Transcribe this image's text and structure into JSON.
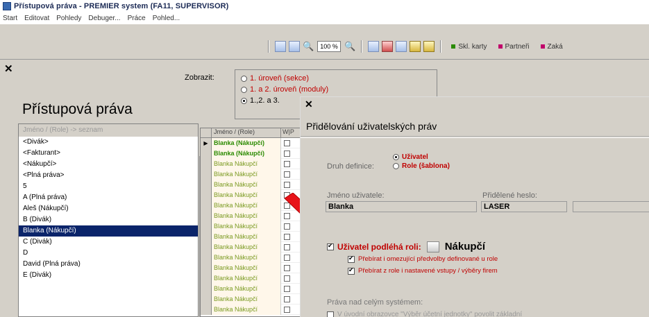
{
  "window": {
    "title": "Přístupová práva - PREMIER system (FA11, SUPERVISOR)"
  },
  "menu": [
    "Start",
    "Editovat",
    "Pohledy",
    "Debuger...",
    "Práce",
    "Pohled..."
  ],
  "toolbar": {
    "zoom": "100 %",
    "links": [
      {
        "label": "Skl. karty",
        "color": "#2a8a00"
      },
      {
        "label": "Partneři",
        "color": "#c0006a"
      },
      {
        "label": "Zaká",
        "color": "#c0006a"
      }
    ]
  },
  "main": {
    "display_label": "Zobrazit:",
    "levels": [
      {
        "label": "1. úroveň (sekce)",
        "selected": false,
        "highlight": true
      },
      {
        "label": "1. a 2. úroveň (moduly)",
        "selected": false,
        "highlight": true
      },
      {
        "label": "1.,2. a 3.",
        "selected": true,
        "highlight": false
      }
    ],
    "page_title": "Přístupová práva",
    "list_header": "Jméno / (Role) -> seznam",
    "list_items": [
      "<Divák>",
      "<Fakturant>",
      "<Nákupčí>",
      "<Plná práva>",
      "5",
      "A (Plná práva)",
      "Aleš (Nákupčí)",
      "B (Divák)",
      "Blanka (Nákupčí)",
      "C (Divák)",
      "D",
      "David (Plná práva)",
      "E (Divák)"
    ],
    "selected_index": 8,
    "grid_headers": {
      "name": "Jméno / (Role)",
      "col": "W|P"
    },
    "grid_rows": [
      "Blanka (Nákupčí)",
      "Blanka (Nákupčí)",
      "Blanka Nákupčí",
      "Blanka Nákupčí",
      "Blanka Nákupčí",
      "Blanka Nákupčí",
      "Blanka Nákupčí",
      "Blanka Nákupčí",
      "Blanka Nákupčí",
      "Blanka Nákupčí",
      "Blanka Nákupčí",
      "Blanka Nákupčí",
      "Blanka Nákupčí",
      "Blanka Nákupčí",
      "Blanka Nákupčí",
      "Blanka Nákupčí",
      "Blanka Nákupčí"
    ]
  },
  "dialog": {
    "title": "Přidělování uživatelských práv",
    "definition_label": "Druh definice:",
    "definition_options": [
      "Uživatel",
      "Role (šablona)"
    ],
    "definition_selected": 0,
    "username_label": "Jméno uživatele:",
    "username_value": "Blanka",
    "password_label": "Přidělené heslo:",
    "password_value": "LASER",
    "role_checkbox_label": "Uživatel podléhá roli:",
    "role_name": "Nákupčí",
    "sub_options": [
      "Přebírat i omezující předvolby definované u role",
      "Přebírat z role i nastavené vstupy / výběry firem"
    ],
    "system_label": "Práva nad celým systémem:",
    "last_option": "V úvodní obrazovce \"Výběr účetní jednotky\" povolit základní"
  }
}
